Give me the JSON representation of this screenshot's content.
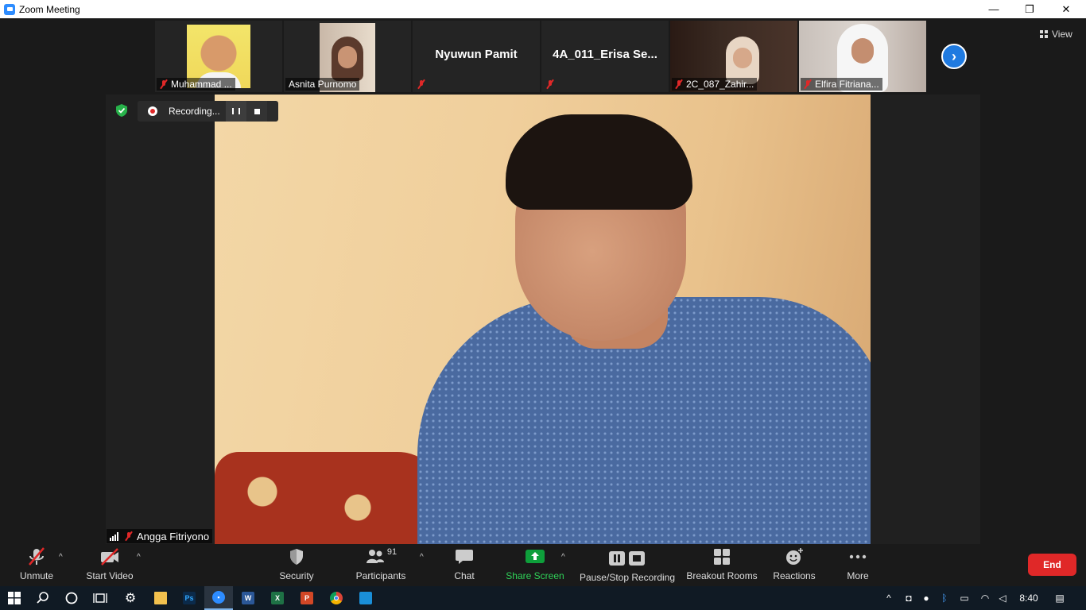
{
  "window": {
    "title": "Zoom Meeting",
    "controls": {
      "minimize": "—",
      "restore": "❐",
      "close": "✕"
    }
  },
  "view_button": {
    "label": "View"
  },
  "participants_strip": [
    {
      "name": "Muhammad ...",
      "muted": true,
      "video": true
    },
    {
      "name": "Asnita Purnomo",
      "muted": false,
      "video": true
    },
    {
      "name": "Nyuwun Pamit",
      "muted": true,
      "video": false
    },
    {
      "name": "4A_011_Erisa  Se...",
      "muted": true,
      "video": false
    },
    {
      "name": "2C_087_Zahir...",
      "muted": true,
      "video": true
    },
    {
      "name": "Elfira Fitriana...",
      "muted": true,
      "video": true
    }
  ],
  "recording": {
    "label": "Recording..."
  },
  "active_speaker": {
    "name": "Angga Fitriyono",
    "muted": true
  },
  "toolbar": {
    "unmute": "Unmute",
    "start_video": "Start Video",
    "security": "Security",
    "participants": "Participants",
    "participants_count": "91",
    "chat": "Chat",
    "share_screen": "Share Screen",
    "recording": "Pause/Stop Recording",
    "breakout_rooms": "Breakout Rooms",
    "reactions": "Reactions",
    "more": "More",
    "end": "End"
  },
  "taskbar": {
    "time": "8:40"
  },
  "colors": {
    "accent": "#2d8cff",
    "share_green": "#0e9f3b",
    "end_red": "#e02828",
    "muted_red": "#e02828"
  }
}
